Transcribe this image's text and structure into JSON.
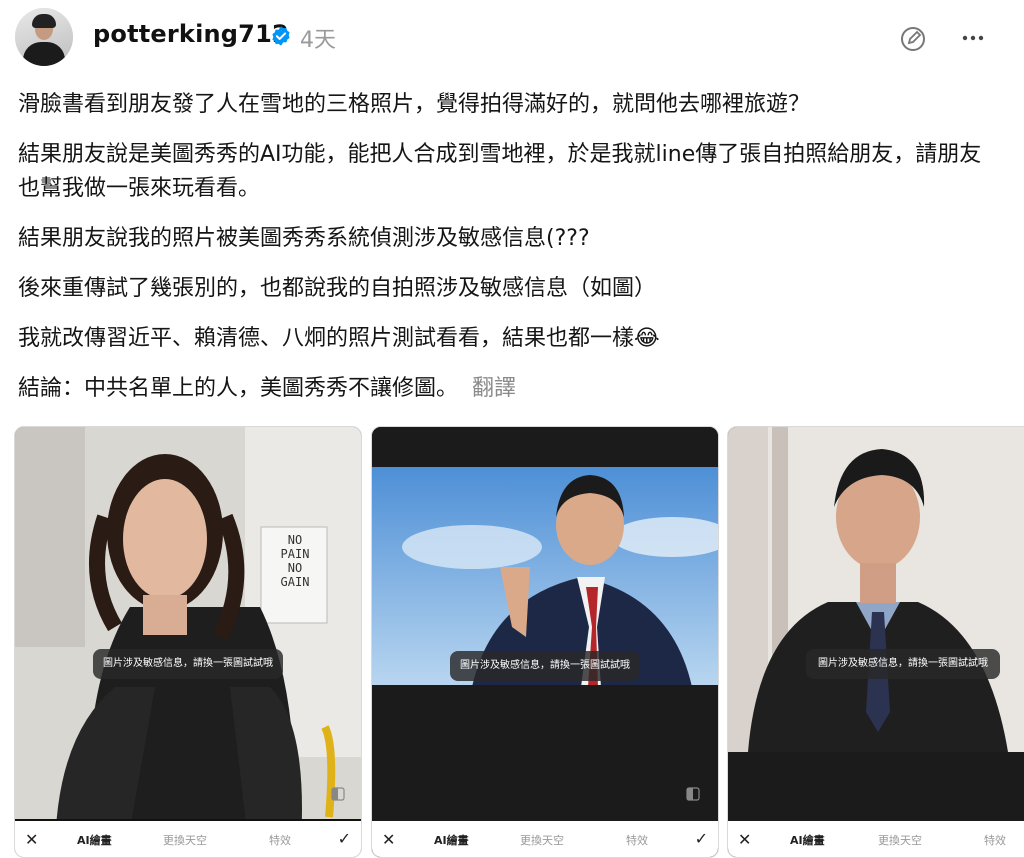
{
  "header": {
    "username": "potterking712",
    "time": "4天",
    "icons": [
      "verified-badge-icon",
      "edit-icon",
      "more-icon"
    ]
  },
  "post": {
    "paragraphs": [
      "滑臉書看到朋友發了人在雪地的三格照片，覺得拍得滿好的，就問他去哪裡旅遊？",
      "結果朋友說是美圖秀秀的AI功能，能把人合成到雪地裡，於是我就line傳了張自拍照給朋友，請朋友也幫我做一張來玩看看。",
      "結果朋友說我的照片被美圖秀秀系統偵測涉及敏感信息(???",
      "後來重傳試了幾張別的，也都說我的自拍照涉及敏感信息（如圖）",
      "我就改傳習近平、賴清德、八炯的照片測試看看，結果也都一樣😂"
    ],
    "conclusion": "結論：中共名單上的人，美圖秀秀不讓修圖。",
    "translate_label": "翻譯"
  },
  "images": [
    {
      "toast": "圖片涉及敏感信息，請換一張圖試試哦",
      "sign_lines": [
        "NO",
        "PAIN",
        "NO",
        "GAIN"
      ],
      "bar": {
        "ai": "AI繪畫",
        "sky": "更換天空",
        "fx": "特效"
      }
    },
    {
      "toast": "圖片涉及敏感信息，請換一張圖試試哦",
      "bar": {
        "ai": "AI繪畫",
        "sky": "更換天空",
        "fx": "特效"
      }
    },
    {
      "toast": "圖片涉及敏感信息，請換一張圖試試哦",
      "bar": {
        "ai": "AI繪畫",
        "sky": "更換天空",
        "fx": "特效"
      }
    }
  ],
  "colors": {
    "verified": "#0095f6",
    "text": "#151515",
    "muted": "#8a8a8a"
  }
}
